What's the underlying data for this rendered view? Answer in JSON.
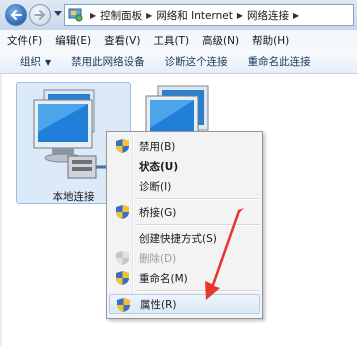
{
  "address_bar": {
    "breadcrumbs": [
      "控制面板",
      "网络和 Internet",
      "网络连接"
    ]
  },
  "menu_bar": {
    "items": [
      "文件(F)",
      "编辑(E)",
      "查看(V)",
      "工具(T)",
      "高级(N)",
      "帮助(H)"
    ]
  },
  "command_bar": {
    "organize": "组织",
    "disable_device": "禁用此网络设备",
    "diagnose": "诊断这个连接",
    "rename": "重命名此连接"
  },
  "connections": [
    {
      "label": "本地连接",
      "selected": true
    },
    {
      "label": "",
      "selected": false
    }
  ],
  "context_menu": {
    "items": [
      {
        "label": "禁用(B)",
        "shield": true
      },
      {
        "label": "状态(U)",
        "bold": true
      },
      {
        "label": "诊断(I)"
      },
      {
        "label": "桥接(G)",
        "shield": true
      },
      {
        "label": "创建快捷方式(S)"
      },
      {
        "label": "删除(D)",
        "shield": true,
        "disabled": true
      },
      {
        "label": "重命名(M)",
        "shield": true
      },
      {
        "label": "属性(R)",
        "shield": true,
        "highlighted": true
      }
    ]
  },
  "colors": {
    "selection_tile": "#dce9f8",
    "annotation_arrow": "#e8362f",
    "command_text": "#1e395b"
  },
  "icons": [
    "back-arrow-icon",
    "forward-arrow-icon",
    "control-panel-icon",
    "network-computer-icon",
    "uac-shield-icon"
  ]
}
